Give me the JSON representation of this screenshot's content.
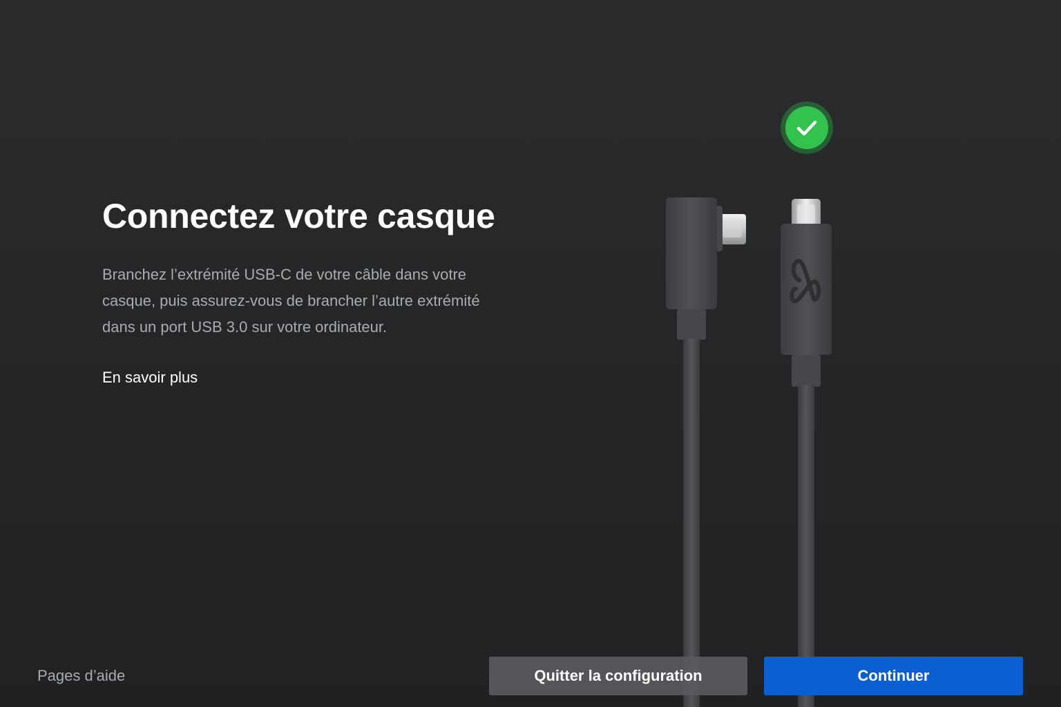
{
  "main": {
    "title": "Connectez votre casque",
    "description": "Branchez l’extrémité USB-C de votre câble dans votre casque, puis assurez-vous de brancher l’autre extrémité dans un port USB 3.0 sur votre ordinateur.",
    "learn_more_label": "En savoir plus"
  },
  "illustration": {
    "status_icon": "check-icon",
    "status_color": "#34c24f",
    "cable_color": "#4a4b4e",
    "logo_icon": "meta-logo-icon"
  },
  "footer": {
    "help_label": "Pages d’aide",
    "quit_label": "Quitter la configuration",
    "continue_label": "Continuer",
    "continue_color": "#0b5fd0"
  }
}
